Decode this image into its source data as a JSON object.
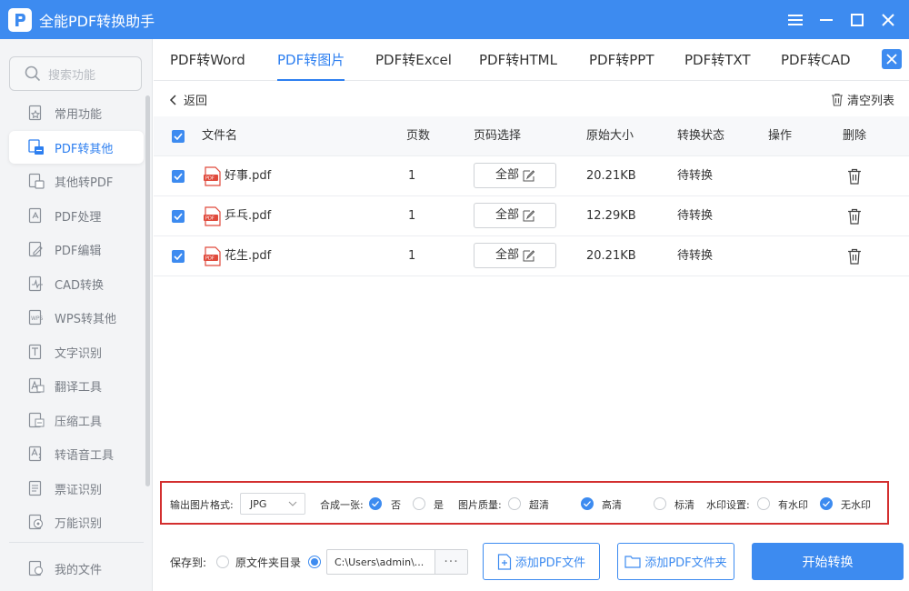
{
  "app": {
    "title": "全能PDF转换助手",
    "accent": "#3d8bf0",
    "highlight_border": "#d32f2f"
  },
  "search": {
    "placeholder": "搜索功能"
  },
  "sidebar": {
    "items": [
      {
        "label": "常用功能",
        "icon": "star-doc-icon"
      },
      {
        "label": "PDF转其他",
        "icon": "pdf-convert-icon",
        "active": true
      },
      {
        "label": "其他转PDF",
        "icon": "doc-to-pdf-icon"
      },
      {
        "label": "PDF处理",
        "icon": "pdf-process-icon"
      },
      {
        "label": "PDF编辑",
        "icon": "pdf-edit-icon"
      },
      {
        "label": "CAD转换",
        "icon": "cad-icon"
      },
      {
        "label": "WPS转其他",
        "icon": "wps-icon"
      },
      {
        "label": "文字识别",
        "icon": "ocr-icon"
      },
      {
        "label": "翻译工具",
        "icon": "translate-icon"
      },
      {
        "label": "压缩工具",
        "icon": "compress-icon"
      },
      {
        "label": "转语音工具",
        "icon": "voice-icon"
      },
      {
        "label": "票证识别",
        "icon": "ticket-icon"
      },
      {
        "label": "万能识别",
        "icon": "universal-scan-icon"
      }
    ],
    "my_files": "我的文件"
  },
  "tabs": [
    {
      "label": "PDF转Word"
    },
    {
      "label": "PDF转图片",
      "active": true
    },
    {
      "label": "PDF转Excel"
    },
    {
      "label": "PDF转HTML"
    },
    {
      "label": "PDF转PPT"
    },
    {
      "label": "PDF转TXT"
    },
    {
      "label": "PDF转CAD"
    }
  ],
  "toolbar": {
    "back": "返回",
    "clear": "清空列表"
  },
  "table": {
    "headers": {
      "name": "文件名",
      "pages": "页数",
      "page_select": "页码选择",
      "size": "原始大小",
      "status": "转换状态",
      "action": "操作",
      "delete": "删除"
    },
    "rows": [
      {
        "name": "好事.pdf",
        "pages": "1",
        "page_select": "全部",
        "size": "20.21KB",
        "status": "待转换"
      },
      {
        "name": "乒乓.pdf",
        "pages": "1",
        "page_select": "全部",
        "size": "12.29KB",
        "status": "待转换"
      },
      {
        "name": "花生.pdf",
        "pages": "1",
        "page_select": "全部",
        "size": "20.21KB",
        "status": "待转换"
      }
    ]
  },
  "options": {
    "format_label": "输出图片格式:",
    "format_value": "JPG",
    "merge_label": "合成一张:",
    "merge_no": "否",
    "merge_yes": "是",
    "quality_label": "图片质量:",
    "quality_ultra": "超清",
    "quality_high": "高清",
    "quality_std": "标清",
    "watermark_label": "水印设置:",
    "watermark_yes": "有水印",
    "watermark_no": "无水印"
  },
  "bottom": {
    "save_to": "保存到:",
    "original_dir": "原文件夹目录",
    "path": "C:\\Users\\admin\\...",
    "more": "···",
    "add_file": "添加PDF文件",
    "add_folder": "添加PDF文件夹",
    "start": "开始转换"
  }
}
